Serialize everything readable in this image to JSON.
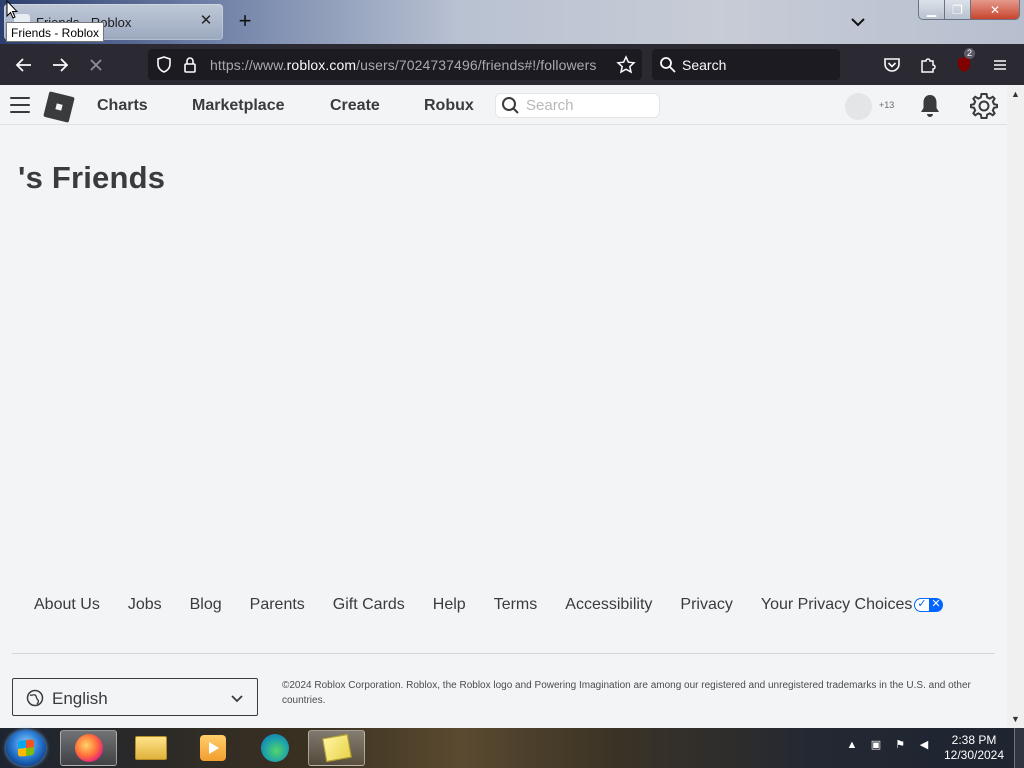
{
  "browser": {
    "tab_title": "Friends - Roblox",
    "tooltip": "Friends - Roblox",
    "url_prefix": "https://www.",
    "url_domain": "roblox.com",
    "url_path": "/users/7024737496/friends#!/followers",
    "search_placeholder": "Search",
    "extension_badge": "2",
    "icons": [
      "back-icon",
      "forward-icon",
      "stop-loading-icon",
      "shield-icon",
      "lock-icon",
      "star-icon",
      "search-icon",
      "pocket-icon",
      "extensions-icon",
      "ublock-icon",
      "menu-icon"
    ]
  },
  "header": {
    "nav": [
      "Charts",
      "Marketplace",
      "Create",
      "Robux"
    ],
    "search_placeholder": "Search",
    "robux_count": "+13"
  },
  "page": {
    "title": "'s Friends"
  },
  "footer": {
    "links": [
      "About Us",
      "Jobs",
      "Blog",
      "Parents",
      "Gift Cards",
      "Help",
      "Terms",
      "Accessibility",
      "Privacy",
      "Your Privacy Choices"
    ],
    "language": "English",
    "copyright": "©2024 Roblox Corporation. Roblox, the Roblox logo and Powering Imagination are among our registered and unregistered trademarks in the U.S. and other countries."
  },
  "taskbar": {
    "time": "2:38 PM",
    "date": "12/30/2024",
    "apps": [
      "firefox-app",
      "file-explorer-app",
      "media-player-app",
      "edge-app",
      "sticky-notes-app"
    ]
  },
  "colors": {
    "roblox_text": "#393b3d",
    "roblox_bg": "#f2f4f5",
    "firefox_toolbar": "#2b2a33",
    "privacy_blue": "#0066ff"
  }
}
